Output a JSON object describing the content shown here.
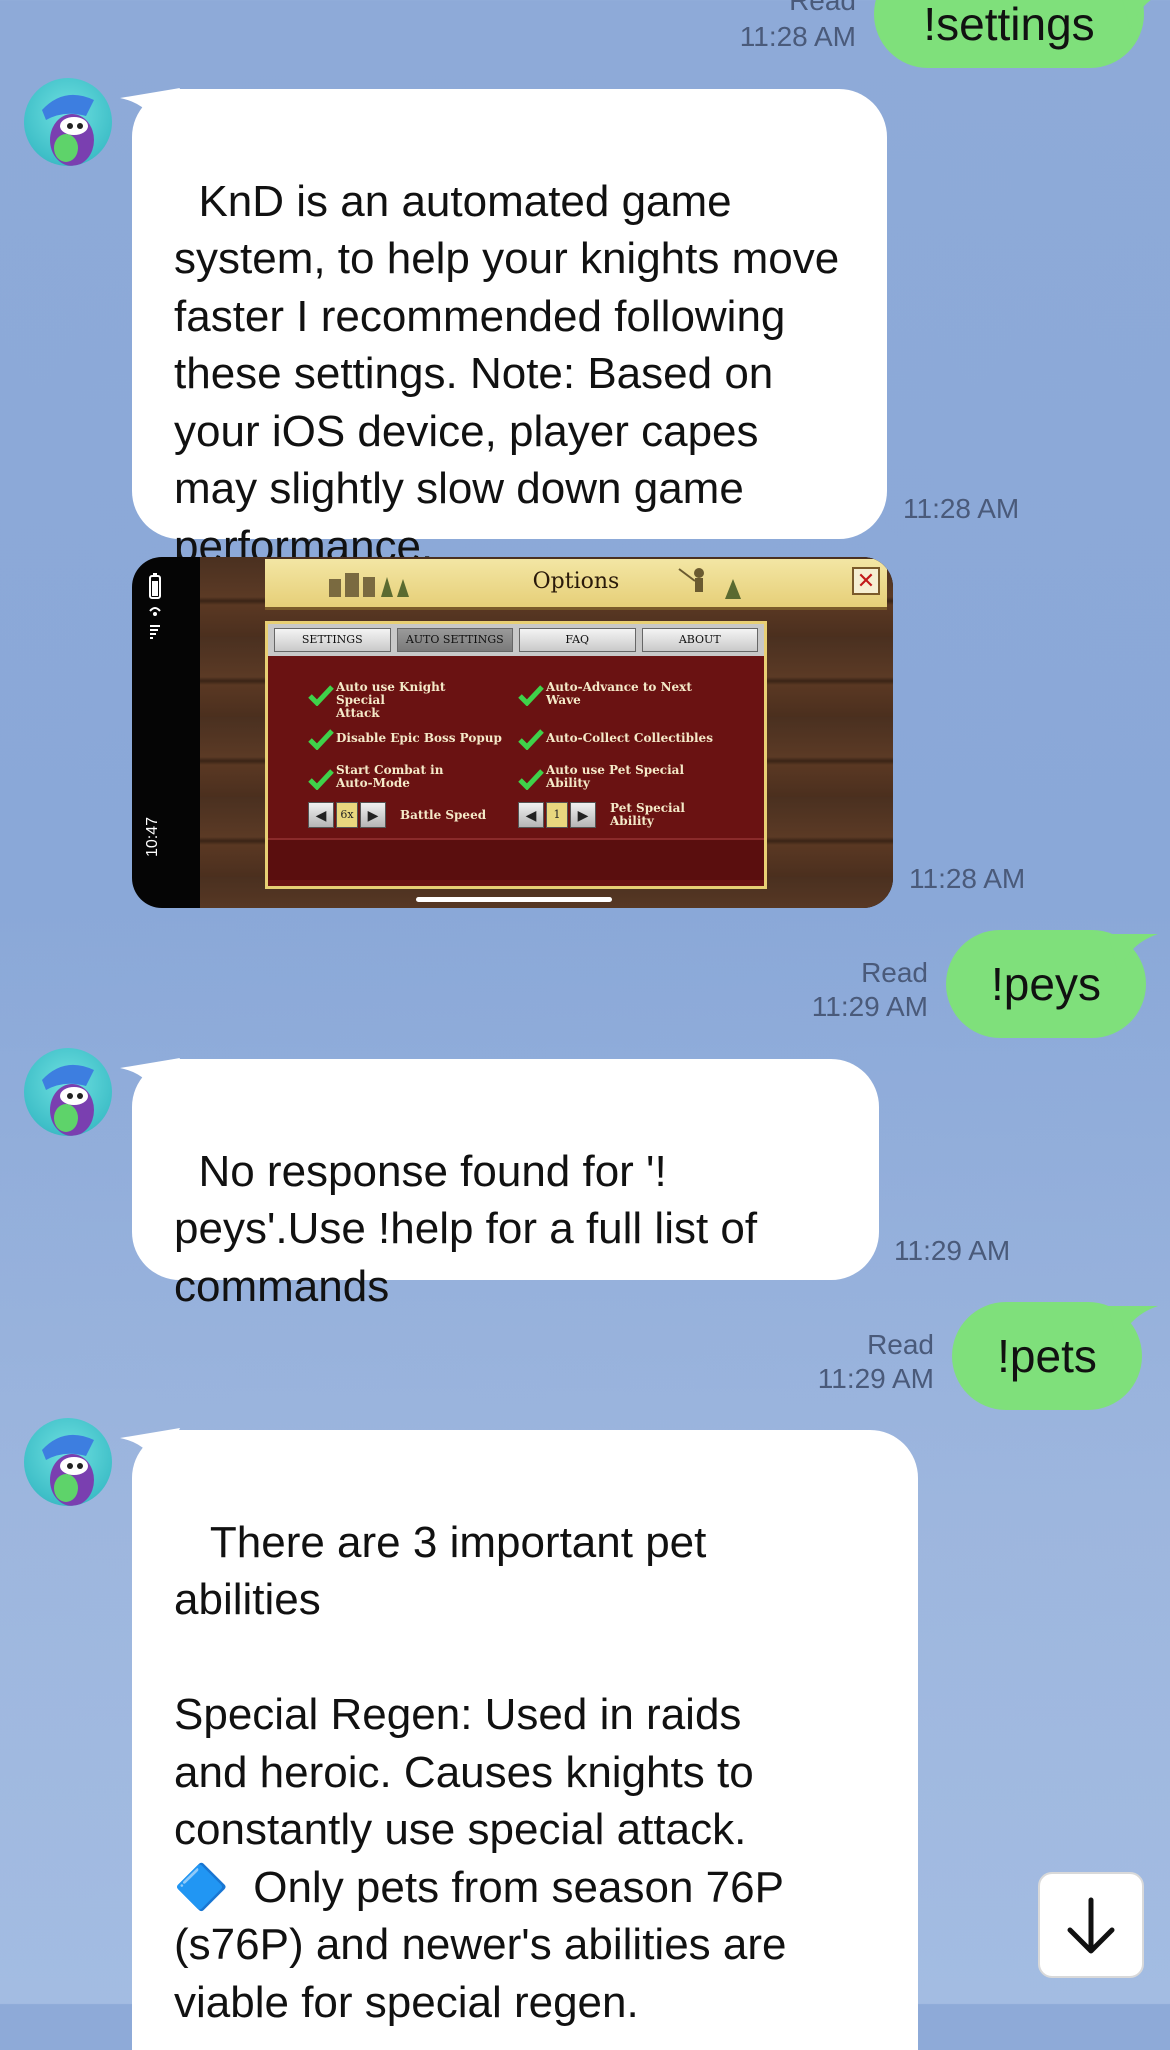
{
  "messages": [
    {
      "id": "m1",
      "side": "out",
      "text": "!settings",
      "read": "Read",
      "time": "11:28 AM"
    },
    {
      "id": "m2",
      "side": "in",
      "text": "KnD is an automated game system, to help your knights move faster I recommended following these settings. Note: Based on your iOS device, player capes may slightly slow down game performance.",
      "time": "11:28 AM"
    },
    {
      "id": "m3",
      "side": "in",
      "type": "image",
      "time": "11:28 AM"
    },
    {
      "id": "m4",
      "side": "out",
      "text": "!peys",
      "read": "Read",
      "time": "11:29 AM"
    },
    {
      "id": "m5",
      "side": "in",
      "text": "No response found for '!\npeys'.Use !help for a full list of\ncommands",
      "time": "11:29 AM"
    },
    {
      "id": "m6",
      "side": "out",
      "text": "!pets",
      "read": "Read",
      "time": "11:29 AM"
    },
    {
      "id": "m7",
      "side": "in",
      "text": " There are 3 important pet\nabilities\n\nSpecial Regen: Used in raids\nand heroic. Causes knights to\nconstantly use special attack.\n🔷  Only pets from season 76P\n(s76P) and newer's abilities are\nviable for special regen."
    }
  ],
  "screenshot": {
    "status_time": "10:47",
    "title": "Options",
    "close": "✕",
    "tabs": [
      "SETTINGS",
      "AUTO SETTINGS",
      "FAQ",
      "ABOUT"
    ],
    "active_tab": "AUTO SETTINGS",
    "options": [
      {
        "label": "Auto use Knight Special\nAttack",
        "checked": true
      },
      {
        "label": "Auto-Advance to Next\nWave",
        "checked": true
      },
      {
        "label": "Disable Epic Boss Popup",
        "checked": true
      },
      {
        "label": "Auto-Collect Collectibles",
        "checked": true
      },
      {
        "label": "Start Combat in\nAuto-Mode",
        "checked": true
      },
      {
        "label": "Auto use Pet Special\nAbility",
        "checked": true
      }
    ],
    "battle_speed": {
      "value": "6x",
      "label": "Battle Speed"
    },
    "pet_special": {
      "value": "1",
      "label": "Pet Special\nAbility"
    }
  },
  "icons": {
    "avatar": "bot-avatar-icon",
    "scroll": "arrow-down-icon"
  },
  "colors": {
    "background": "#8eaad8",
    "outgoing_bubble": "#7fe07b",
    "incoming_bubble": "#ffffff",
    "timestamp": "#4a5a7a"
  }
}
